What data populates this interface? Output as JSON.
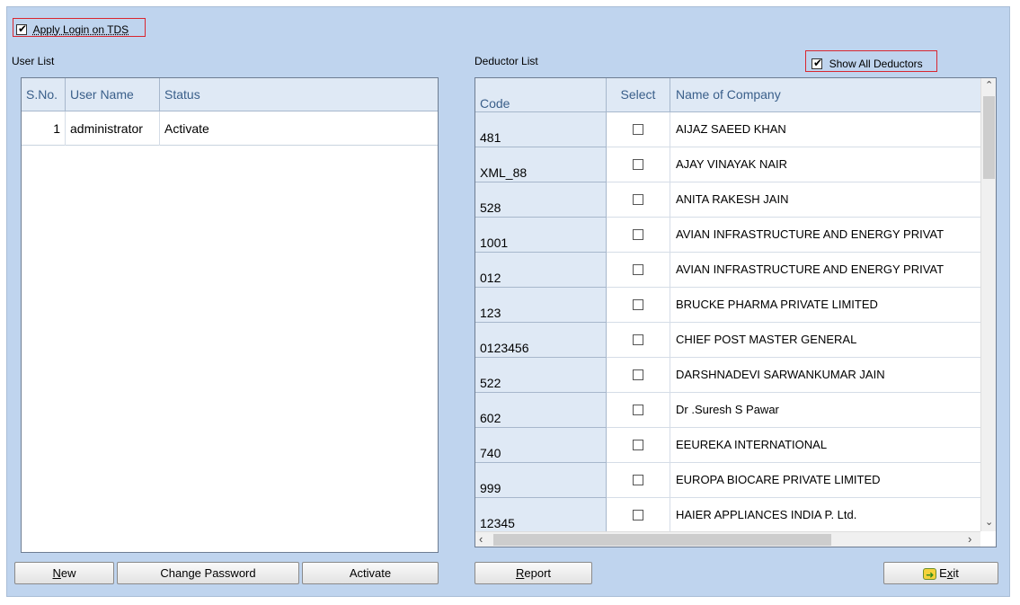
{
  "apply_login": {
    "label": "Apply Login on TDS",
    "checked": true
  },
  "user_list": {
    "title": "User List",
    "columns": [
      "S.No.",
      "User Name",
      "Status"
    ],
    "rows": [
      {
        "sno": "1",
        "user_name": "administrator",
        "status": "Activate"
      }
    ]
  },
  "deductor_list": {
    "title": "Deductor List",
    "show_all": {
      "label": "Show All Deductors",
      "checked": true
    },
    "columns": [
      "Code",
      "Select",
      "Name of Company"
    ],
    "rows": [
      {
        "code": "481",
        "selected": false,
        "name": "AIJAZ SAEED KHAN"
      },
      {
        "code": "XML_88",
        "selected": false,
        "name": "AJAY VINAYAK NAIR"
      },
      {
        "code": "528",
        "selected": false,
        "name": "ANITA RAKESH JAIN"
      },
      {
        "code": "1001",
        "selected": false,
        "name": "AVIAN INFRASTRUCTURE AND ENERGY PRIVAT"
      },
      {
        "code": "012",
        "selected": false,
        "name": "AVIAN INFRASTRUCTURE AND ENERGY PRIVAT"
      },
      {
        "code": "123",
        "selected": false,
        "name": "BRUCKE PHARMA PRIVATE LIMITED"
      },
      {
        "code": "0123456",
        "selected": false,
        "name": "CHIEF POST MASTER GENERAL"
      },
      {
        "code": "522",
        "selected": false,
        "name": "DARSHNADEVI SARWANKUMAR JAIN"
      },
      {
        "code": "602",
        "selected": false,
        "name": "Dr .Suresh S Pawar"
      },
      {
        "code": "740",
        "selected": false,
        "name": "EEUREKA INTERNATIONAL"
      },
      {
        "code": "999",
        "selected": false,
        "name": "EUROPA BIOCARE PRIVATE LIMITED"
      },
      {
        "code": "12345",
        "selected": false,
        "name": "HAIER APPLIANCES INDIA P. Ltd."
      }
    ]
  },
  "buttons": {
    "new": {
      "mnemonic": "N",
      "rest": "ew"
    },
    "change_password": "Change Password",
    "activate": "Activate",
    "report": {
      "mnemonic": "R",
      "rest": "eport"
    },
    "exit": {
      "prefix": "E",
      "mnemonic": "x",
      "rest": "it"
    }
  }
}
